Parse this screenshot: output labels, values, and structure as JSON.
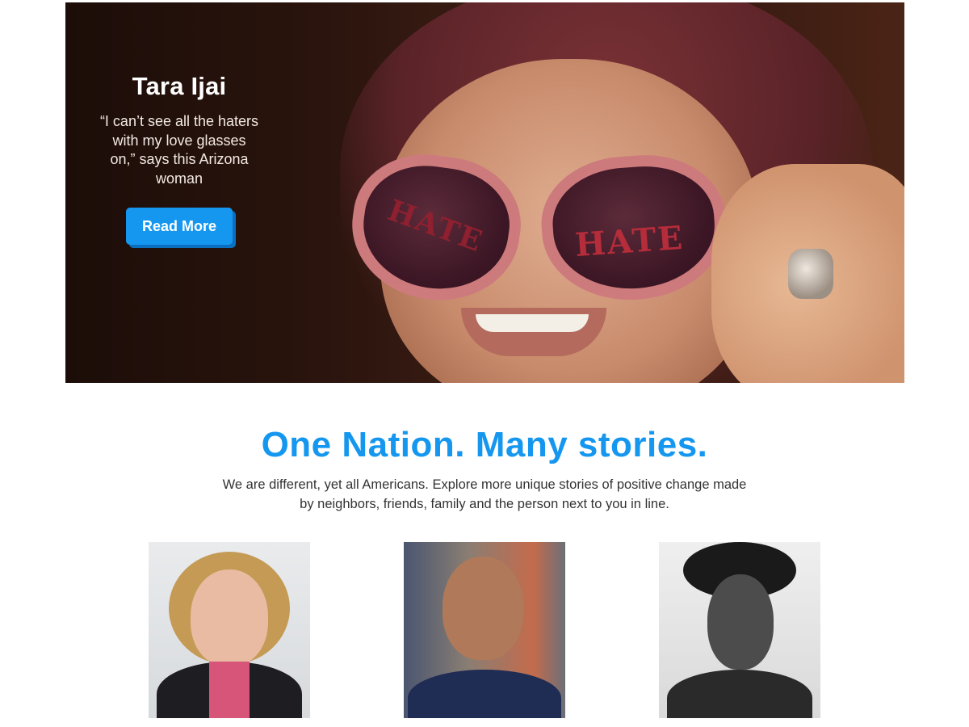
{
  "hero": {
    "name": "Tara Ijai",
    "quote": "“I can’t see all the haters with my love glasses on,” says this Arizona woman",
    "cta_label": "Read More",
    "lens_text": "HATE"
  },
  "section": {
    "title": "One Nation. Many stories.",
    "subtitle": "We are different, yet all Americans. Explore more unique stories of positive change made by neighbors, friends, family and the person next to you in line."
  },
  "colors": {
    "accent": "#1597f0",
    "button_shadow": "#0b6fc0"
  }
}
